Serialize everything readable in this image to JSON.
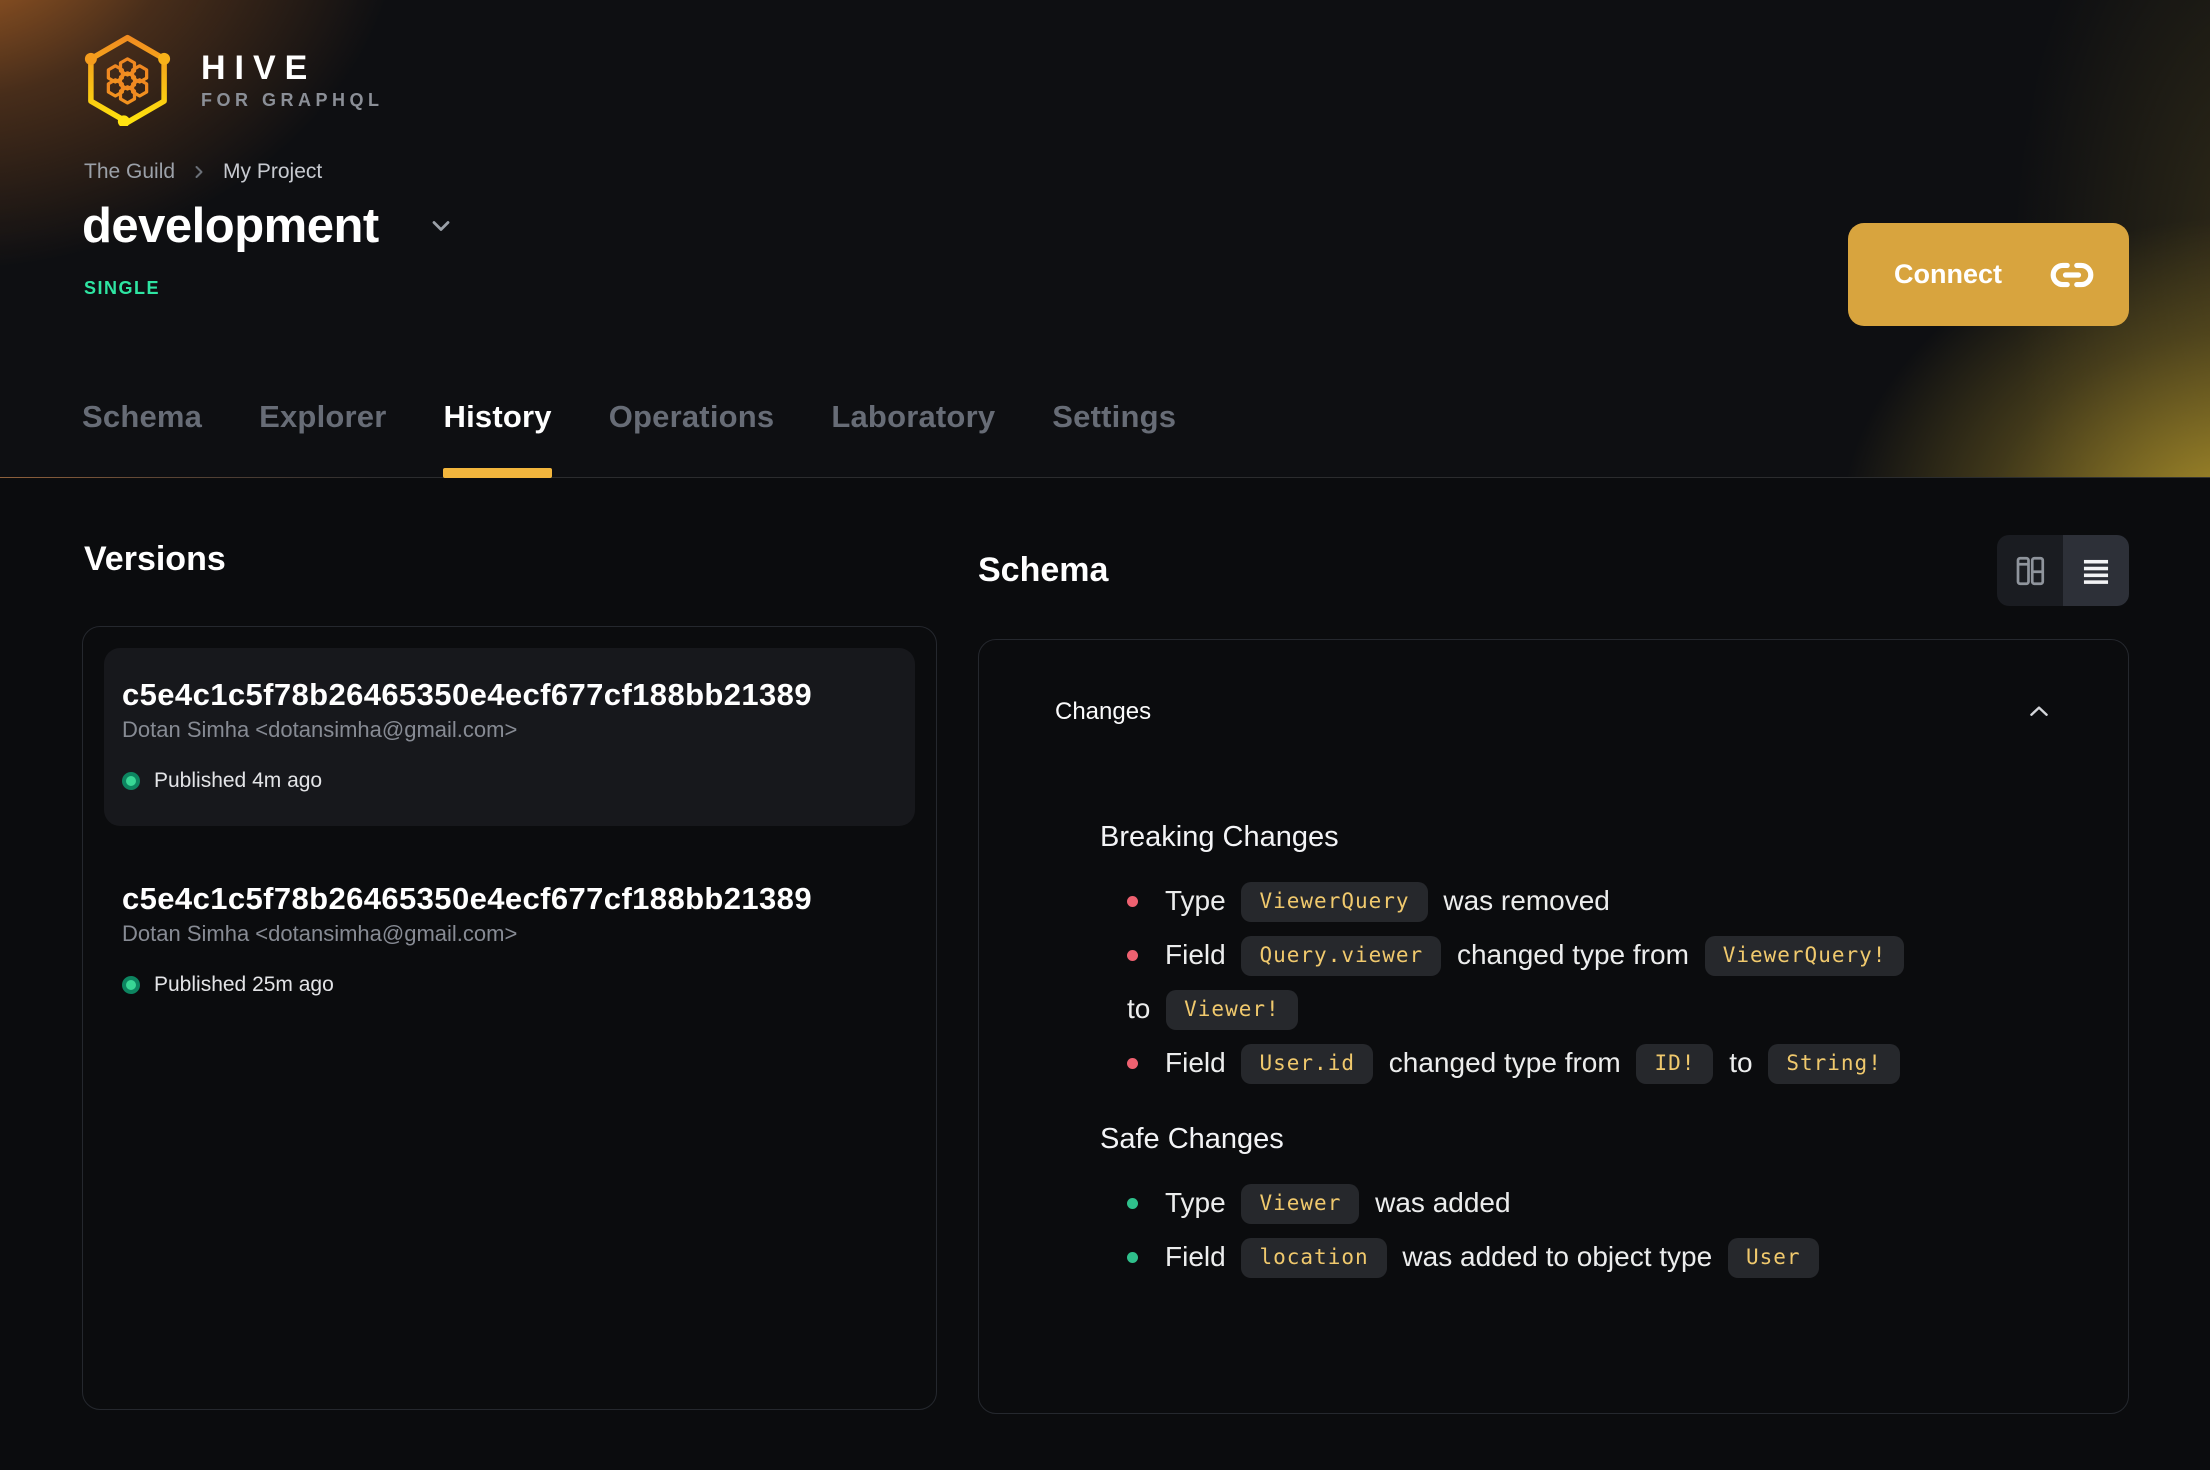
{
  "brand": {
    "name": "HIVE",
    "tagline": "FOR GRAPHQL"
  },
  "breadcrumb": {
    "org": "The Guild",
    "project": "My Project"
  },
  "target": {
    "name": "development",
    "badge": "SINGLE"
  },
  "actions": {
    "connect_label": "Connect"
  },
  "tabs": [
    {
      "label": "Schema",
      "active": false
    },
    {
      "label": "Explorer",
      "active": false
    },
    {
      "label": "History",
      "active": true
    },
    {
      "label": "Operations",
      "active": false
    },
    {
      "label": "Laboratory",
      "active": false
    },
    {
      "label": "Settings",
      "active": false
    }
  ],
  "versions": {
    "heading": "Versions",
    "items": [
      {
        "hash": "c5e4c1c5f78b26465350e4ecf677cf188bb21389",
        "author": "Dotan Simha <dotansimha@gmail.com>",
        "status": "Published 4m ago",
        "selected": true
      },
      {
        "hash": "c5e4c1c5f78b26465350e4ecf677cf188bb21389",
        "author": "Dotan Simha <dotansimha@gmail.com>",
        "status": "Published 25m ago",
        "selected": false
      }
    ]
  },
  "schema": {
    "heading": "Schema",
    "view_toggle": [
      "columns-view",
      "list-view"
    ],
    "changes": {
      "title": "Changes",
      "collapsed": false,
      "sections": [
        {
          "title": "Breaking Changes",
          "kind": "breaking",
          "items": [
            [
              {
                "text": "Type"
              },
              {
                "code": "ViewerQuery"
              },
              {
                "text": "was removed"
              }
            ],
            [
              {
                "text": "Field"
              },
              {
                "code": "Query.viewer"
              },
              {
                "text": "changed type from"
              },
              {
                "code": "ViewerQuery!"
              },
              {
                "text": "to",
                "br": true
              },
              {
                "code": "Viewer!"
              }
            ],
            [
              {
                "text": "Field"
              },
              {
                "code": "User.id"
              },
              {
                "text": "changed type from"
              },
              {
                "code": "ID!"
              },
              {
                "text": "to"
              },
              {
                "code": "String!"
              }
            ]
          ]
        },
        {
          "title": "Safe Changes",
          "kind": "safe",
          "items": [
            [
              {
                "text": "Type"
              },
              {
                "code": "Viewer"
              },
              {
                "text": "was added"
              }
            ],
            [
              {
                "text": "Field"
              },
              {
                "code": "location"
              },
              {
                "text": "was added to object type"
              },
              {
                "code": "User"
              }
            ]
          ]
        }
      ]
    }
  },
  "colors": {
    "accent": "#f2b63d",
    "connect_bg": "#d8a43e",
    "badge": "#2ee5a2",
    "breaking": "#ee6170",
    "safe": "#2fc08b",
    "code_text": "#f0c96d",
    "published_dot": "#38d795"
  }
}
